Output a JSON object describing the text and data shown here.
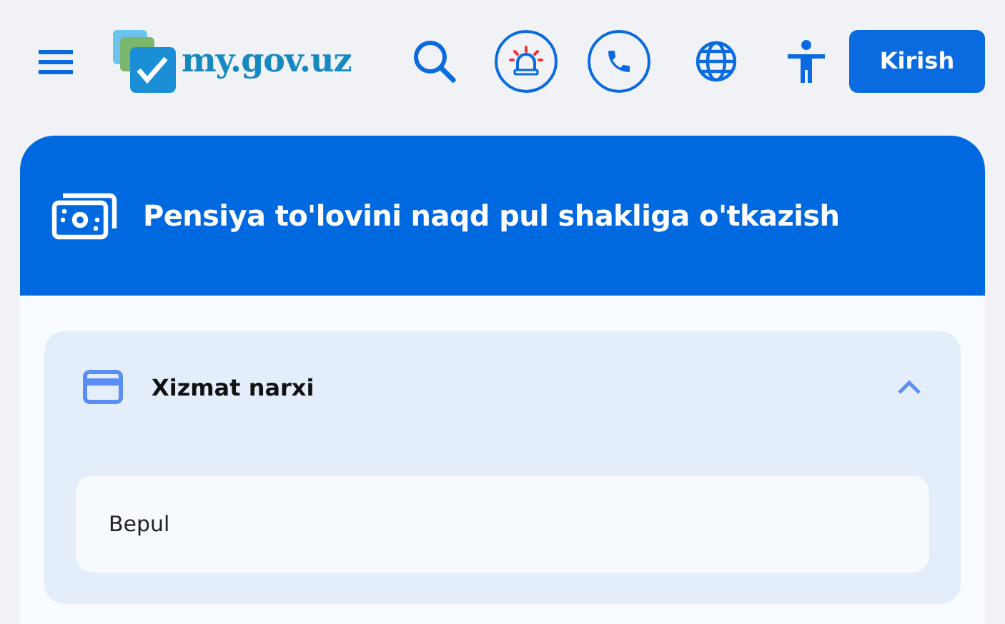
{
  "header": {
    "logo_text": "my.gov.uz",
    "login_button": "Kirish"
  },
  "service": {
    "title": "Pensiya to'lovini naqd pul shakliga o'tkazish",
    "sections": [
      {
        "title": "Xizmat narxi",
        "expanded": true,
        "content": "Bepul"
      }
    ]
  }
}
